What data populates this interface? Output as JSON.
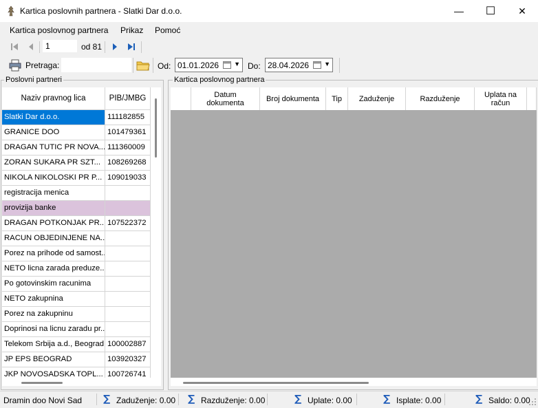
{
  "window": {
    "title": "Kartica poslovnih partnera - Slatki Dar d.o.o.",
    "minimize_glyph": "—",
    "maximize_glyph": "☐",
    "close_glyph": "✕"
  },
  "menu": {
    "items": [
      {
        "label": "Kartica poslovnog partnera"
      },
      {
        "label": "Prikaz"
      },
      {
        "label": "Pomoć"
      }
    ]
  },
  "navigator": {
    "position": "1",
    "of_label": "od 81",
    "icons": [
      "first-record-icon",
      "previous-record-icon",
      "next-record-icon",
      "last-record-icon"
    ]
  },
  "toolbar": {
    "search_label": "Pretraga:",
    "search_value": "",
    "od_label": "Od:",
    "od_value": "01.01.2026",
    "do_label": "Do:",
    "do_value": "28.04.2026",
    "icons": [
      "printer-icon",
      "folder-icon",
      "calendar-icon"
    ]
  },
  "partners_panel": {
    "title": "Poslovni partneri",
    "columns": [
      "Naziv pravnog lica",
      "PIB/JMBG"
    ],
    "rows": [
      {
        "name": "Slatki Dar d.o.o.",
        "pib": "111182855",
        "state": "selected"
      },
      {
        "name": "GRANICE DOO",
        "pib": "101479361",
        "state": ""
      },
      {
        "name": "DRAGAN TUTIC PR NOVA...",
        "pib": "111360009",
        "state": ""
      },
      {
        "name": "ZORAN SUKARA PR SZT...",
        "pib": "108269268",
        "state": ""
      },
      {
        "name": "NIKOLA NIKOLOSKI PR P...",
        "pib": "109019033",
        "state": ""
      },
      {
        "name": "registracija menica",
        "pib": "",
        "state": ""
      },
      {
        "name": "provizija banke",
        "pib": "",
        "state": "pink"
      },
      {
        "name": "DRAGAN POTKONJAK PR...",
        "pib": "107522372",
        "state": ""
      },
      {
        "name": "RACUN OBJEDINJENE NA...",
        "pib": "",
        "state": ""
      },
      {
        "name": "Porez na prihode od samost...",
        "pib": "",
        "state": ""
      },
      {
        "name": "NETO licna zarada preduze...",
        "pib": "",
        "state": ""
      },
      {
        "name": "Po gotovinskim racunima",
        "pib": "",
        "state": ""
      },
      {
        "name": "NETO zakupnina",
        "pib": "",
        "state": ""
      },
      {
        "name": "Porez na zakupninu",
        "pib": "",
        "state": ""
      },
      {
        "name": "Doprinosi na licnu zaradu pr...",
        "pib": "",
        "state": ""
      },
      {
        "name": "Telekom Srbija a.d., Beograd",
        "pib": "100002887",
        "state": ""
      },
      {
        "name": "JP EPS BEOGRAD",
        "pib": "103920327",
        "state": ""
      },
      {
        "name": "JKP NOVOSADSKA TOPL...",
        "pib": "100726741",
        "state": ""
      }
    ]
  },
  "card_panel": {
    "title": "Kartica poslovnog partnera",
    "columns": [
      "",
      "Datum dokumenta",
      "Broj dokumenta",
      "Tip",
      "Zaduženje",
      "Razduženje",
      "Uplata na račun"
    ]
  },
  "status": {
    "company": "Dramin doo Novi Sad",
    "zaduzenje": "Zaduženje: 0.00",
    "razduzenje": "Razduženje: 0.00",
    "uplate": "Uplate: 0.00",
    "isplate": "Isplate: 0.00",
    "saldo": "Saldo: 0.00",
    "sigma_glyph": "∑"
  },
  "colors": {
    "selection": "#0078d7",
    "pink_row": "#dbc3dc",
    "empty_grid": "#ababab",
    "sigma": "#1e5bb8"
  }
}
